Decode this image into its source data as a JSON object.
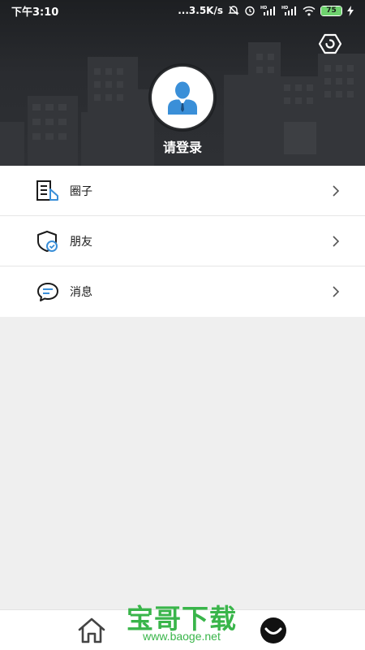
{
  "status_bar": {
    "time": "下午3:10",
    "network_speed": "...3.5K/s",
    "battery_level": "75",
    "signal_label_1": "HD",
    "signal_label_2": "HD"
  },
  "header": {
    "settings_icon": "settings-hexagon-icon",
    "avatar_icon": "user-avatar-icon",
    "login_label": "请登录"
  },
  "menu": {
    "items": [
      {
        "label": "圈子",
        "icon": "document-icon"
      },
      {
        "label": "朋友",
        "icon": "shield-icon"
      },
      {
        "label": "消息",
        "icon": "chat-bubble-icon"
      }
    ]
  },
  "tabbar": {
    "home_icon": "home-icon",
    "me_icon": "smile-icon"
  },
  "watermark": {
    "title": "宝哥下载",
    "url": "www.baoge.net"
  },
  "colors": {
    "header_bg": "#2a2c30",
    "page_bg": "#efefef",
    "accent_blue": "#3a8fd8",
    "watermark_green": "#39b54a"
  }
}
